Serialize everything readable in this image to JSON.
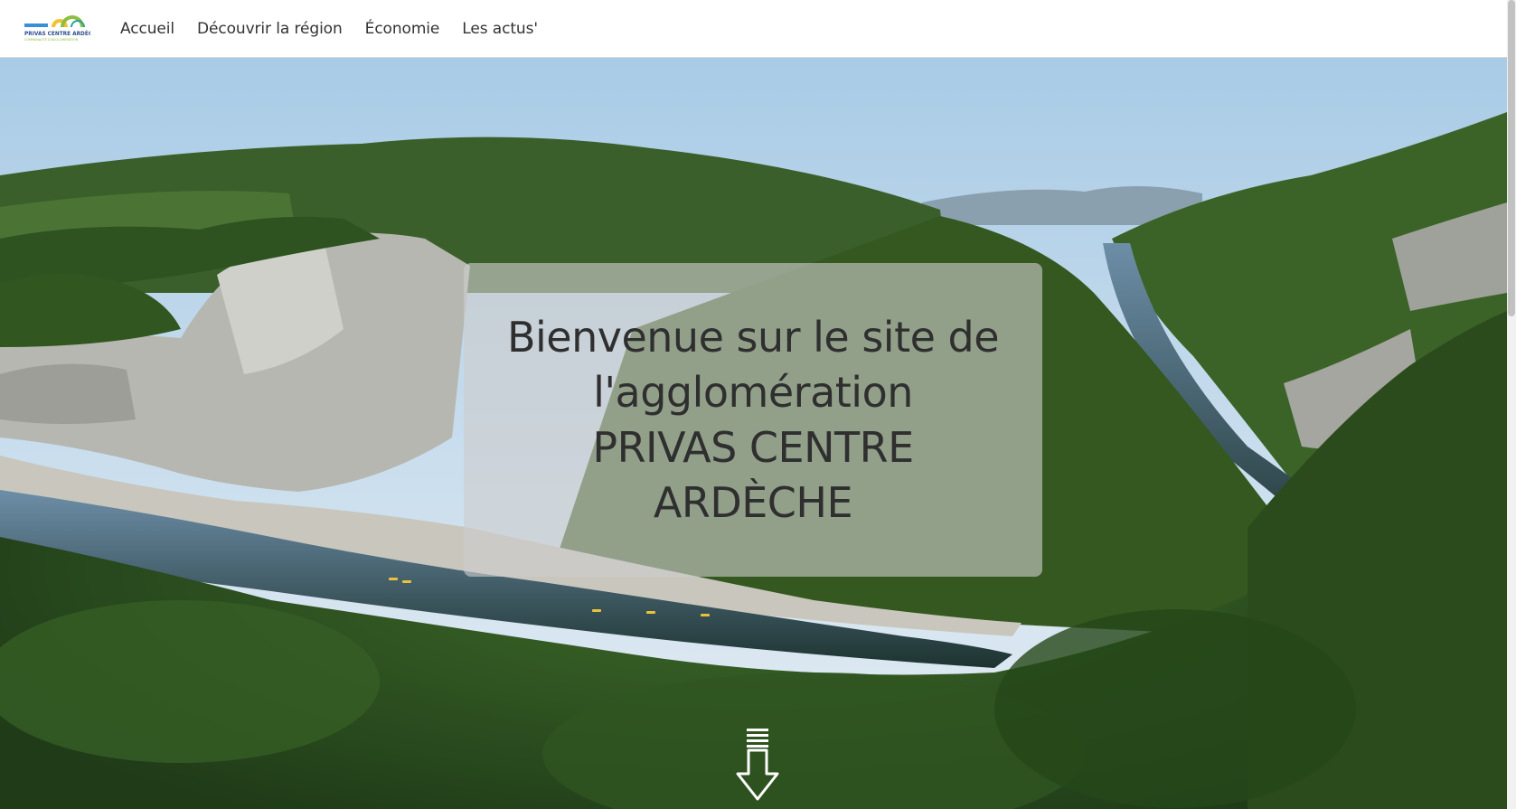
{
  "header": {
    "logo": {
      "text_line1": "PRIVAS CENTRE ARDÈCHE",
      "text_line2": "COMMUNAUTÉ D'AGGLOMÉRATION",
      "colors": {
        "blue": "#3b8fd6",
        "green": "#8cbf3f",
        "yellow": "#f2c230",
        "teal": "#2aa39a"
      }
    },
    "nav": [
      {
        "label": "Accueil"
      },
      {
        "label": "Découvrir la région"
      },
      {
        "label": "Économie"
      },
      {
        "label": "Les actus'"
      }
    ]
  },
  "hero": {
    "image": "gorge-river-landscape",
    "title_lines": [
      "Bienvenue sur le site de",
      "l'agglomération",
      "PRIVAS CENTRE",
      "ARDÈCHE"
    ],
    "scroll_icon": "arrow-down-icon"
  }
}
